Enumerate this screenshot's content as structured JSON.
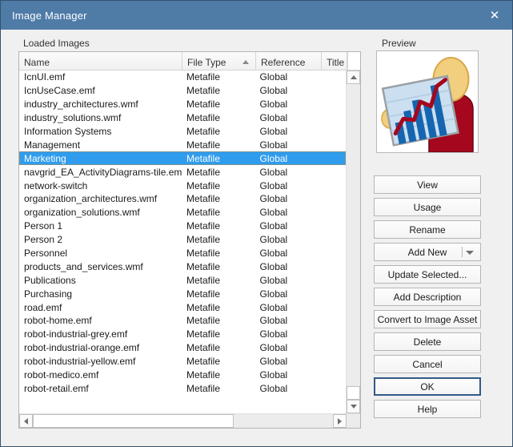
{
  "window": {
    "title": "Image Manager",
    "close_label": "✕"
  },
  "list_section": {
    "group_label": "Loaded Images",
    "columns": [
      {
        "key": "name",
        "label": "Name",
        "sorted": false
      },
      {
        "key": "type",
        "label": "File Type",
        "sorted": true,
        "sort_dir": "asc"
      },
      {
        "key": "ref",
        "label": "Reference",
        "sorted": false
      },
      {
        "key": "title",
        "label": "Title",
        "sorted": false
      }
    ],
    "selected_index": 6,
    "rows": [
      {
        "name": "IcnUI.emf",
        "type": "Metafile",
        "ref": "Global",
        "title": ""
      },
      {
        "name": "IcnUseCase.emf",
        "type": "Metafile",
        "ref": "Global",
        "title": ""
      },
      {
        "name": "industry_architectures.wmf",
        "type": "Metafile",
        "ref": "Global",
        "title": ""
      },
      {
        "name": "industry_solutions.wmf",
        "type": "Metafile",
        "ref": "Global",
        "title": ""
      },
      {
        "name": "Information Systems",
        "type": "Metafile",
        "ref": "Global",
        "title": ""
      },
      {
        "name": "Management",
        "type": "Metafile",
        "ref": "Global",
        "title": ""
      },
      {
        "name": "Marketing",
        "type": "Metafile",
        "ref": "Global",
        "title": ""
      },
      {
        "name": "navgrid_EA_ActivityDiagrams-tile.emf",
        "type": "Metafile",
        "ref": "Global",
        "title": ""
      },
      {
        "name": "network-switch",
        "type": "Metafile",
        "ref": "Global",
        "title": ""
      },
      {
        "name": "organization_architectures.wmf",
        "type": "Metafile",
        "ref": "Global",
        "title": ""
      },
      {
        "name": "organization_solutions.wmf",
        "type": "Metafile",
        "ref": "Global",
        "title": ""
      },
      {
        "name": "Person 1",
        "type": "Metafile",
        "ref": "Global",
        "title": ""
      },
      {
        "name": "Person 2",
        "type": "Metafile",
        "ref": "Global",
        "title": ""
      },
      {
        "name": "Personnel",
        "type": "Metafile",
        "ref": "Global",
        "title": ""
      },
      {
        "name": "products_and_services.wmf",
        "type": "Metafile",
        "ref": "Global",
        "title": ""
      },
      {
        "name": "Publications",
        "type": "Metafile",
        "ref": "Global",
        "title": ""
      },
      {
        "name": "Purchasing",
        "type": "Metafile",
        "ref": "Global",
        "title": ""
      },
      {
        "name": "road.emf",
        "type": "Metafile",
        "ref": "Global",
        "title": ""
      },
      {
        "name": "robot-home.emf",
        "type": "Metafile",
        "ref": "Global",
        "title": ""
      },
      {
        "name": "robot-industrial-grey.emf",
        "type": "Metafile",
        "ref": "Global",
        "title": ""
      },
      {
        "name": "robot-industrial-orange.emf",
        "type": "Metafile",
        "ref": "Global",
        "title": ""
      },
      {
        "name": "robot-industrial-yellow.emf",
        "type": "Metafile",
        "ref": "Global",
        "title": ""
      },
      {
        "name": "robot-medico.emf",
        "type": "Metafile",
        "ref": "Global",
        "title": ""
      },
      {
        "name": "robot-retail.emf",
        "type": "Metafile",
        "ref": "Global",
        "title": ""
      }
    ]
  },
  "preview": {
    "label": "Preview",
    "image_name": "marketing-presenter-chart-illustration"
  },
  "buttons": [
    {
      "key": "view",
      "label": "View",
      "dropdown": false,
      "default": false
    },
    {
      "key": "usage",
      "label": "Usage",
      "dropdown": false,
      "default": false
    },
    {
      "key": "rename",
      "label": "Rename",
      "dropdown": false,
      "default": false
    },
    {
      "key": "add-new",
      "label": "Add New",
      "dropdown": true,
      "default": false
    },
    {
      "key": "update",
      "label": "Update Selected...",
      "dropdown": false,
      "default": false
    },
    {
      "key": "add-desc",
      "label": "Add Description",
      "dropdown": false,
      "default": false
    },
    {
      "key": "convert",
      "label": "Convert to Image Asset",
      "dropdown": false,
      "default": false
    },
    {
      "key": "delete",
      "label": "Delete",
      "dropdown": false,
      "default": false
    },
    {
      "key": "cancel",
      "label": "Cancel",
      "dropdown": false,
      "default": false
    },
    {
      "key": "ok",
      "label": "OK",
      "dropdown": false,
      "default": true
    },
    {
      "key": "help",
      "label": "Help",
      "dropdown": false,
      "default": false
    }
  ],
  "colors": {
    "titlebar": "#4f7ba7",
    "dialog_border": "#34516e",
    "dialog_bg": "#f0f0f0",
    "selection": "#2f9ced",
    "default_button_border": "#33598a"
  }
}
